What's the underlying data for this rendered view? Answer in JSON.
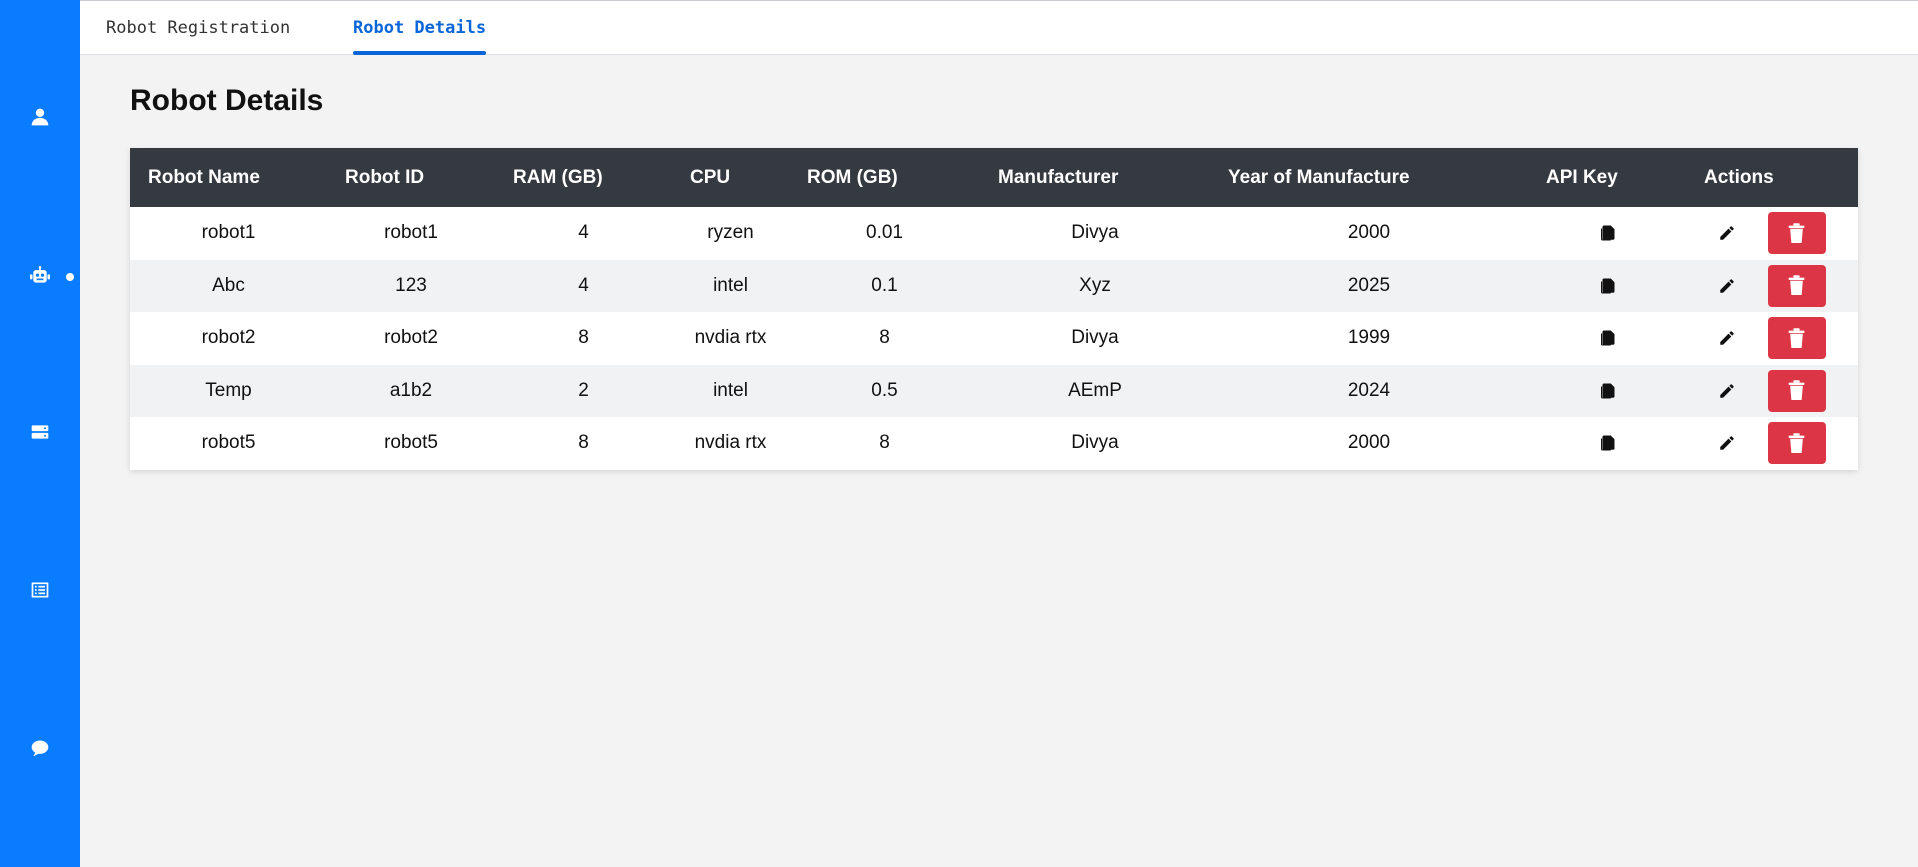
{
  "nav": {
    "tabs": [
      {
        "label": "Robot Registration"
      },
      {
        "label": "Robot Details"
      }
    ],
    "sidebar_icons": [
      "user-icon",
      "robot-icon",
      "server-icon",
      "list-icon",
      "chat-icon"
    ],
    "active_sidebar": "robot-icon"
  },
  "page": {
    "title": "Robot Details"
  },
  "table": {
    "headers": [
      "Robot Name",
      "Robot ID",
      "RAM (GB)",
      "CPU",
      "ROM (GB)",
      "Manufacturer",
      "Year of Manufacture",
      "API Key",
      "Actions"
    ],
    "rows": [
      {
        "name": "robot1",
        "id": "robot1",
        "ram": "4",
        "cpu": "ryzen",
        "rom": "0.01",
        "manufacturer": "Divya",
        "year": "2000"
      },
      {
        "name": "Abc",
        "id": "123",
        "ram": "4",
        "cpu": "intel",
        "rom": "0.1",
        "manufacturer": "Xyz",
        "year": "2025"
      },
      {
        "name": "robot2",
        "id": "robot2",
        "ram": "8",
        "cpu": "nvdia rtx",
        "rom": "8",
        "manufacturer": "Divya",
        "year": "1999"
      },
      {
        "name": "Temp",
        "id": "a1b2",
        "ram": "2",
        "cpu": "intel",
        "rom": "0.5",
        "manufacturer": "AEmP",
        "year": "2024"
      },
      {
        "name": "robot5",
        "id": "robot5",
        "ram": "8",
        "cpu": "nvdia rtx",
        "rom": "8",
        "manufacturer": "Divya",
        "year": "2000"
      }
    ]
  },
  "colors": {
    "sidebar": "#0a7cff",
    "header_bg": "#343a40",
    "accent": "#0a66d8",
    "delete": "#dc3545"
  }
}
